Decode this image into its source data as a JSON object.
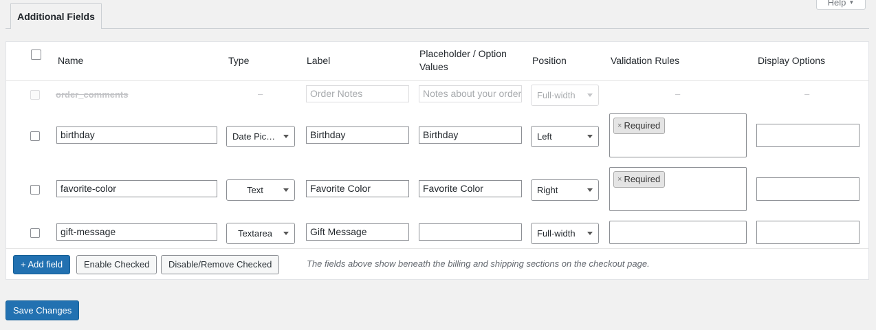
{
  "help": {
    "label": "Help",
    "icon": "caret-down-icon"
  },
  "tabs": [
    {
      "label": "Additional Fields",
      "active": true
    }
  ],
  "table": {
    "headers": {
      "name": "Name",
      "type": "Type",
      "label": "Label",
      "placeholder_line1": "Placeholder / Option",
      "placeholder_line2": "Values",
      "position": "Position",
      "validation": "Validation Rules",
      "display": "Display Options"
    },
    "rows": [
      {
        "name": "order_comments",
        "type": "–",
        "label_placeholder": "Order Notes",
        "placeholder_placeholder": "Notes about your order",
        "position": "Full-width",
        "validation": "–",
        "display": "–",
        "disabled": true
      },
      {
        "name": "birthday",
        "type": "Date Pic…",
        "label": "Birthday",
        "placeholder": "Birthday",
        "position": "Left",
        "validation_tags": [
          "Required"
        ],
        "display": ""
      },
      {
        "name": "favorite-color",
        "type": "Text",
        "label": "Favorite Color",
        "placeholder": "Favorite Color",
        "position": "Right",
        "validation_tags": [
          "Required"
        ],
        "display": ""
      },
      {
        "name": "gift-message",
        "type": "Textarea",
        "label": "Gift Message",
        "placeholder": "",
        "position": "Full-width",
        "validation_tags": [],
        "display": ""
      }
    ]
  },
  "footer": {
    "add_field": "+ Add field",
    "enable_checked": "Enable Checked",
    "disable_remove_checked": "Disable/Remove Checked",
    "note": "The fields above show beneath the billing and shipping sections on the checkout page."
  },
  "save_changes": "Save Changes",
  "tag_remove_symbol": "×",
  "colors": {
    "primary": "#2271b1",
    "background": "#f1f1f1"
  }
}
